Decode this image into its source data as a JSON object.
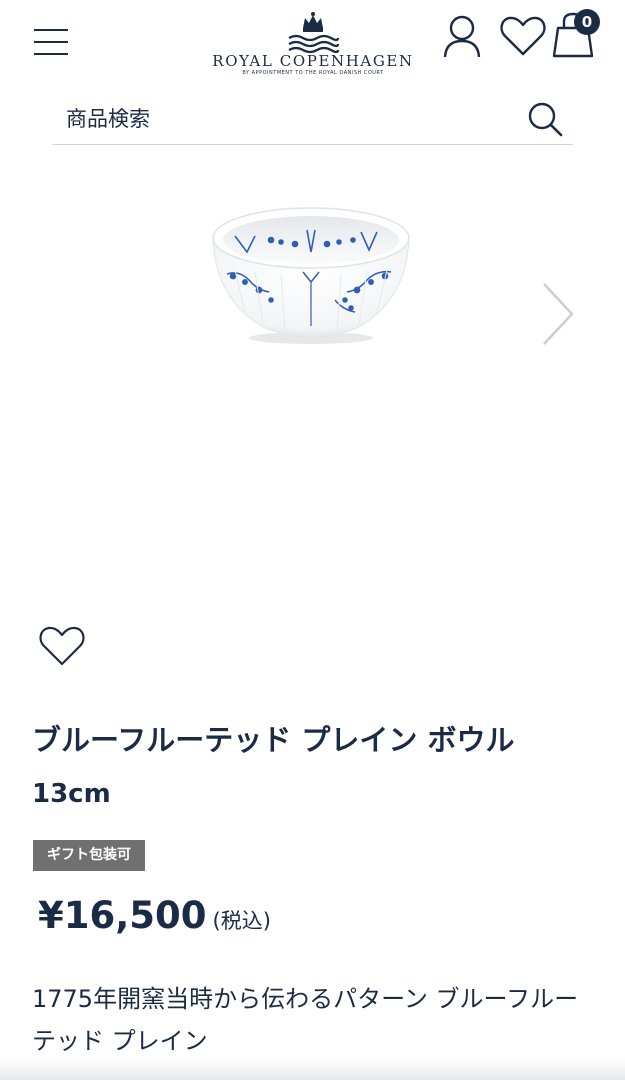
{
  "header": {
    "menu_icon": "hamburger-menu-icon",
    "brand_name": "ROYAL COPENHAGEN",
    "brand_tagline": "BY APPOINTMENT TO THE ROYAL DANISH COURT",
    "account_icon": "person-icon",
    "wishlist_icon": "heart-icon",
    "cart_icon": "shopping-bag-icon",
    "cart_count": "0"
  },
  "search": {
    "placeholder": "商品検索",
    "icon": "search-icon"
  },
  "product": {
    "image_alt": "ブルーフルーテッド プレイン ボウル 13cm",
    "next_icon": "chevron-right-icon",
    "favorite_icon": "heart-icon",
    "title": "ブルーフルーテッド プレイン ボウル",
    "size": "13cm",
    "badge": "ギフト包装可",
    "price": "¥16,500",
    "tax_label": "(税込)",
    "description": "1775年開窯当時から伝わるパターン ブルーフルーテッド プレイン"
  },
  "colors": {
    "text": "#1c2b45",
    "badge_bg": "#707070",
    "divider": "#d2d6dc",
    "pattern_blue": "#2f5fb3"
  }
}
